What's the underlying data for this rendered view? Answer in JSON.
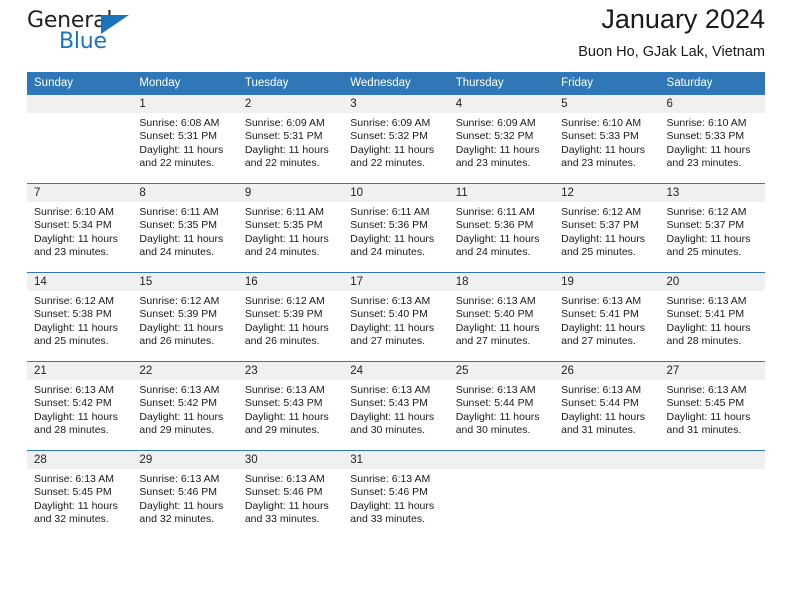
{
  "logo": {
    "word1": "General",
    "word2": "Blue",
    "triangle": "triangle-icon",
    "accent_color": "#1b74bb"
  },
  "header": {
    "title": "January 2024",
    "subtitle": "Buon Ho, GJak Lak, Vietnam"
  },
  "calendar": {
    "header_color": "#2f77b7",
    "day_band_color": "#f0f0f0",
    "weekdays": [
      "Sunday",
      "Monday",
      "Tuesday",
      "Wednesday",
      "Thursday",
      "Friday",
      "Saturday"
    ],
    "weeks": [
      [
        {
          "day": "",
          "empty": true
        },
        {
          "day": "1",
          "sunrise": "Sunrise: 6:08 AM",
          "sunset": "Sunset: 5:31 PM",
          "daylight1": "Daylight: 11 hours",
          "daylight2": "and 22 minutes."
        },
        {
          "day": "2",
          "sunrise": "Sunrise: 6:09 AM",
          "sunset": "Sunset: 5:31 PM",
          "daylight1": "Daylight: 11 hours",
          "daylight2": "and 22 minutes."
        },
        {
          "day": "3",
          "sunrise": "Sunrise: 6:09 AM",
          "sunset": "Sunset: 5:32 PM",
          "daylight1": "Daylight: 11 hours",
          "daylight2": "and 22 minutes."
        },
        {
          "day": "4",
          "sunrise": "Sunrise: 6:09 AM",
          "sunset": "Sunset: 5:32 PM",
          "daylight1": "Daylight: 11 hours",
          "daylight2": "and 23 minutes."
        },
        {
          "day": "5",
          "sunrise": "Sunrise: 6:10 AM",
          "sunset": "Sunset: 5:33 PM",
          "daylight1": "Daylight: 11 hours",
          "daylight2": "and 23 minutes."
        },
        {
          "day": "6",
          "sunrise": "Sunrise: 6:10 AM",
          "sunset": "Sunset: 5:33 PM",
          "daylight1": "Daylight: 11 hours",
          "daylight2": "and 23 minutes."
        }
      ],
      [
        {
          "day": "7",
          "sunrise": "Sunrise: 6:10 AM",
          "sunset": "Sunset: 5:34 PM",
          "daylight1": "Daylight: 11 hours",
          "daylight2": "and 23 minutes."
        },
        {
          "day": "8",
          "sunrise": "Sunrise: 6:11 AM",
          "sunset": "Sunset: 5:35 PM",
          "daylight1": "Daylight: 11 hours",
          "daylight2": "and 24 minutes."
        },
        {
          "day": "9",
          "sunrise": "Sunrise: 6:11 AM",
          "sunset": "Sunset: 5:35 PM",
          "daylight1": "Daylight: 11 hours",
          "daylight2": "and 24 minutes."
        },
        {
          "day": "10",
          "sunrise": "Sunrise: 6:11 AM",
          "sunset": "Sunset: 5:36 PM",
          "daylight1": "Daylight: 11 hours",
          "daylight2": "and 24 minutes."
        },
        {
          "day": "11",
          "sunrise": "Sunrise: 6:11 AM",
          "sunset": "Sunset: 5:36 PM",
          "daylight1": "Daylight: 11 hours",
          "daylight2": "and 24 minutes."
        },
        {
          "day": "12",
          "sunrise": "Sunrise: 6:12 AM",
          "sunset": "Sunset: 5:37 PM",
          "daylight1": "Daylight: 11 hours",
          "daylight2": "and 25 minutes."
        },
        {
          "day": "13",
          "sunrise": "Sunrise: 6:12 AM",
          "sunset": "Sunset: 5:37 PM",
          "daylight1": "Daylight: 11 hours",
          "daylight2": "and 25 minutes."
        }
      ],
      [
        {
          "day": "14",
          "sunrise": "Sunrise: 6:12 AM",
          "sunset": "Sunset: 5:38 PM",
          "daylight1": "Daylight: 11 hours",
          "daylight2": "and 25 minutes."
        },
        {
          "day": "15",
          "sunrise": "Sunrise: 6:12 AM",
          "sunset": "Sunset: 5:39 PM",
          "daylight1": "Daylight: 11 hours",
          "daylight2": "and 26 minutes."
        },
        {
          "day": "16",
          "sunrise": "Sunrise: 6:12 AM",
          "sunset": "Sunset: 5:39 PM",
          "daylight1": "Daylight: 11 hours",
          "daylight2": "and 26 minutes."
        },
        {
          "day": "17",
          "sunrise": "Sunrise: 6:13 AM",
          "sunset": "Sunset: 5:40 PM",
          "daylight1": "Daylight: 11 hours",
          "daylight2": "and 27 minutes."
        },
        {
          "day": "18",
          "sunrise": "Sunrise: 6:13 AM",
          "sunset": "Sunset: 5:40 PM",
          "daylight1": "Daylight: 11 hours",
          "daylight2": "and 27 minutes."
        },
        {
          "day": "19",
          "sunrise": "Sunrise: 6:13 AM",
          "sunset": "Sunset: 5:41 PM",
          "daylight1": "Daylight: 11 hours",
          "daylight2": "and 27 minutes."
        },
        {
          "day": "20",
          "sunrise": "Sunrise: 6:13 AM",
          "sunset": "Sunset: 5:41 PM",
          "daylight1": "Daylight: 11 hours",
          "daylight2": "and 28 minutes."
        }
      ],
      [
        {
          "day": "21",
          "sunrise": "Sunrise: 6:13 AM",
          "sunset": "Sunset: 5:42 PM",
          "daylight1": "Daylight: 11 hours",
          "daylight2": "and 28 minutes."
        },
        {
          "day": "22",
          "sunrise": "Sunrise: 6:13 AM",
          "sunset": "Sunset: 5:42 PM",
          "daylight1": "Daylight: 11 hours",
          "daylight2": "and 29 minutes."
        },
        {
          "day": "23",
          "sunrise": "Sunrise: 6:13 AM",
          "sunset": "Sunset: 5:43 PM",
          "daylight1": "Daylight: 11 hours",
          "daylight2": "and 29 minutes."
        },
        {
          "day": "24",
          "sunrise": "Sunrise: 6:13 AM",
          "sunset": "Sunset: 5:43 PM",
          "daylight1": "Daylight: 11 hours",
          "daylight2": "and 30 minutes."
        },
        {
          "day": "25",
          "sunrise": "Sunrise: 6:13 AM",
          "sunset": "Sunset: 5:44 PM",
          "daylight1": "Daylight: 11 hours",
          "daylight2": "and 30 minutes."
        },
        {
          "day": "26",
          "sunrise": "Sunrise: 6:13 AM",
          "sunset": "Sunset: 5:44 PM",
          "daylight1": "Daylight: 11 hours",
          "daylight2": "and 31 minutes."
        },
        {
          "day": "27",
          "sunrise": "Sunrise: 6:13 AM",
          "sunset": "Sunset: 5:45 PM",
          "daylight1": "Daylight: 11 hours",
          "daylight2": "and 31 minutes."
        }
      ],
      [
        {
          "day": "28",
          "sunrise": "Sunrise: 6:13 AM",
          "sunset": "Sunset: 5:45 PM",
          "daylight1": "Daylight: 11 hours",
          "daylight2": "and 32 minutes."
        },
        {
          "day": "29",
          "sunrise": "Sunrise: 6:13 AM",
          "sunset": "Sunset: 5:46 PM",
          "daylight1": "Daylight: 11 hours",
          "daylight2": "and 32 minutes."
        },
        {
          "day": "30",
          "sunrise": "Sunrise: 6:13 AM",
          "sunset": "Sunset: 5:46 PM",
          "daylight1": "Daylight: 11 hours",
          "daylight2": "and 33 minutes."
        },
        {
          "day": "31",
          "sunrise": "Sunrise: 6:13 AM",
          "sunset": "Sunset: 5:46 PM",
          "daylight1": "Daylight: 11 hours",
          "daylight2": "and 33 minutes."
        },
        {
          "day": "",
          "empty": true
        },
        {
          "day": "",
          "empty": true
        },
        {
          "day": "",
          "empty": true
        }
      ]
    ]
  }
}
